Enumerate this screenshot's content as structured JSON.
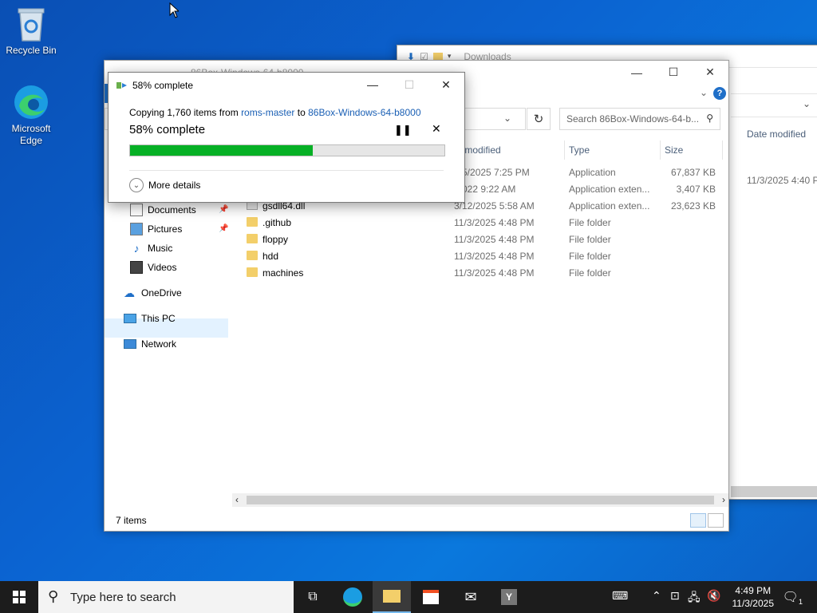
{
  "desktop": {
    "icons": [
      {
        "label": "Recycle Bin"
      },
      {
        "label": "Microsoft Edge"
      }
    ]
  },
  "back_window": {
    "title": "Downloads",
    "column": "Date modified",
    "row_date": "11/3/2025 4:40 P"
  },
  "front_window": {
    "title": "86Box-Windows-64-b8000",
    "search_placeholder": "Search 86Box-Windows-64-b...",
    "columns": {
      "date": "te modified",
      "type": "Type",
      "size": "Size"
    },
    "nav": [
      {
        "label": "Documents",
        "icon": "documents-icon",
        "pinned": true
      },
      {
        "label": "Pictures",
        "icon": "pictures-icon",
        "pinned": true
      },
      {
        "label": "Music",
        "icon": "music-icon",
        "pinned": false
      },
      {
        "label": "Videos",
        "icon": "videos-icon",
        "pinned": false
      },
      {
        "label": "OneDrive",
        "icon": "onedrive-icon",
        "pinned": false
      },
      {
        "label": "This PC",
        "icon": "this-pc-icon",
        "pinned": false
      },
      {
        "label": "Network",
        "icon": "network-icon",
        "pinned": false
      }
    ],
    "files": [
      {
        "name": "",
        "date": "/25/2025 7:25 PM",
        "type": "Application",
        "size": "67,837 KB",
        "icon": "app"
      },
      {
        "name": "",
        "date": "/2022 9:22 AM",
        "type": "Application exten...",
        "size": "3,407 KB",
        "icon": "dll"
      },
      {
        "name": "gsdll64.dll",
        "date": "3/12/2025 5:58 AM",
        "type": "Application exten...",
        "size": "23,623 KB",
        "icon": "dll"
      },
      {
        "name": ".github",
        "date": "11/3/2025 4:48 PM",
        "type": "File folder",
        "size": "",
        "icon": "folder"
      },
      {
        "name": "floppy",
        "date": "11/3/2025 4:48 PM",
        "type": "File folder",
        "size": "",
        "icon": "folder"
      },
      {
        "name": "hdd",
        "date": "11/3/2025 4:48 PM",
        "type": "File folder",
        "size": "",
        "icon": "folder"
      },
      {
        "name": "machines",
        "date": "11/3/2025 4:48 PM",
        "type": "File folder",
        "size": "",
        "icon": "folder"
      }
    ],
    "status": "7 items"
  },
  "copy_dialog": {
    "title": "58% complete",
    "copying_prefix": "Copying 1,760 items from ",
    "source": "roms-master",
    "to_word": " to ",
    "destination": "86Box-Windows-64-b8000",
    "percent_text": "58% complete",
    "progress_fraction": 0.58,
    "more_details": "More details"
  },
  "taskbar": {
    "search_placeholder": "Type here to search",
    "time": "4:49 PM",
    "date": "11/3/2025",
    "notification_count": "1"
  },
  "colors": {
    "progress_fill": "#06b025",
    "link": "#1a5fb4",
    "selection": "#cce8ff"
  }
}
